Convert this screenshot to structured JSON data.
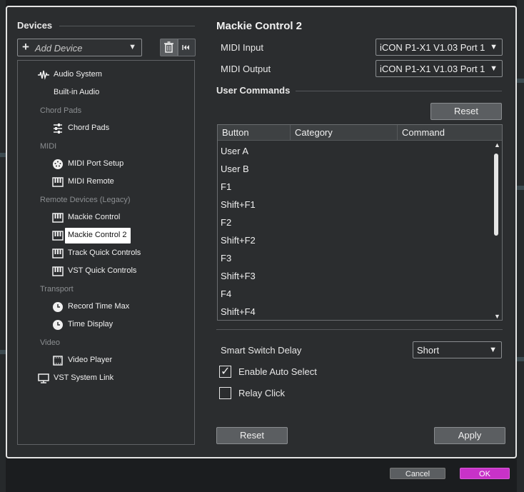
{
  "devices_panel": {
    "title": "Devices",
    "add_device_label": "Add Device"
  },
  "tree": {
    "items": [
      {
        "kind": "item",
        "label": "Audio System",
        "icon": "waveform-icon"
      },
      {
        "kind": "item",
        "label": "Built-in Audio",
        "icon": ""
      },
      {
        "kind": "category",
        "label": "Chord Pads"
      },
      {
        "kind": "item",
        "label": "Chord Pads",
        "icon": "sliders-icon"
      },
      {
        "kind": "category",
        "label": "MIDI"
      },
      {
        "kind": "item",
        "label": "MIDI Port Setup",
        "icon": "midi-port-icon"
      },
      {
        "kind": "item",
        "label": "MIDI Remote",
        "icon": "keyboard-icon"
      },
      {
        "kind": "category",
        "label": "Remote Devices (Legacy)"
      },
      {
        "kind": "item",
        "label": "Mackie Control",
        "icon": "keyboard-icon"
      },
      {
        "kind": "item",
        "label": "Mackie Control 2",
        "icon": "keyboard-icon",
        "selected": true
      },
      {
        "kind": "item",
        "label": "Track Quick Controls",
        "icon": "keyboard-icon"
      },
      {
        "kind": "item",
        "label": "VST Quick Controls",
        "icon": "keyboard-icon"
      },
      {
        "kind": "category",
        "label": "Transport"
      },
      {
        "kind": "item",
        "label": "Record Time Max",
        "icon": "clock-icon"
      },
      {
        "kind": "item",
        "label": "Time Display",
        "icon": "clock-icon"
      },
      {
        "kind": "category",
        "label": "Video"
      },
      {
        "kind": "item",
        "label": "Video Player",
        "icon": "film-icon"
      },
      {
        "kind": "item",
        "label": "VST System Link",
        "icon": "monitor-icon"
      }
    ]
  },
  "device_settings": {
    "title": "Mackie Control 2",
    "midi_input_label": "MIDI Input",
    "midi_input_value": "iCON P1-X1 V1.03 Port 1",
    "midi_output_label": "MIDI Output",
    "midi_output_value": "iCON P1-X1 V1.03 Port 1",
    "user_commands_title": "User Commands",
    "reset_commands_label": "Reset",
    "table": {
      "columns": [
        "Button",
        "Category",
        "Command"
      ],
      "rows": [
        "User A",
        "User B",
        "F1",
        "Shift+F1",
        "F2",
        "Shift+F2",
        "F3",
        "Shift+F3",
        "F4",
        "Shift+F4"
      ]
    },
    "smart_switch_delay_label": "Smart Switch Delay",
    "smart_switch_delay_value": "Short",
    "enable_auto_select_label": "Enable Auto Select",
    "enable_auto_select_checked": true,
    "relay_click_label": "Relay Click",
    "relay_click_checked": false,
    "reset_label": "Reset",
    "apply_label": "Apply"
  },
  "footer": {
    "cancel_label": "Cancel",
    "ok_label": "OK"
  },
  "colors": {
    "dialog_bg": "#2b2d2f",
    "ok_accent": "#c832c8",
    "selection": "#ffffff"
  }
}
